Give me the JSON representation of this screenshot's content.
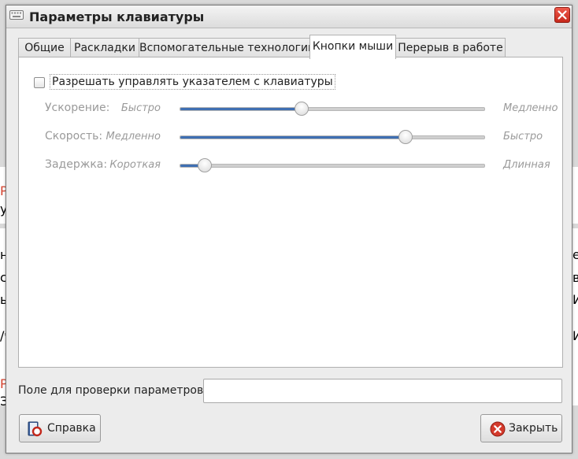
{
  "window": {
    "title": "Параметры клавиатуры"
  },
  "tabs": [
    {
      "label": "Общие"
    },
    {
      "label": "Раскладки"
    },
    {
      "label": "Вспомогательные технологии"
    },
    {
      "label": "Кнопки мыши",
      "active": true
    },
    {
      "label": "Перерыв в работе"
    }
  ],
  "mouse_keys": {
    "enable_checkbox": {
      "label": "Разрешать управлять указателем с клавиатуры",
      "checked": false
    },
    "sliders": [
      {
        "label": "Ускорение:",
        "min_label": "Быстро",
        "max_label": "Медленно",
        "value": 0.4
      },
      {
        "label": "Скорость:",
        "min_label": "Медленно",
        "max_label": "Быстро",
        "value": 0.74
      },
      {
        "label": "Задержка:",
        "min_label": "Короткая",
        "max_label": "Длинная",
        "value": 0.08
      }
    ]
  },
  "test_area": {
    "label": "Поле для проверки параметров:",
    "value": ""
  },
  "buttons": {
    "help": "Справка",
    "close": "Закрыть"
  },
  "background_fragments": {
    "left": [
      "Р",
      "у,",
      "не",
      "с",
      "ы",
      "/ч",
      "Р",
      "З"
    ],
    "right": [
      "е",
      "в",
      "И",
      "И"
    ]
  },
  "colors": {
    "accent": "#3f6fb2",
    "close": "#d43a2c"
  }
}
